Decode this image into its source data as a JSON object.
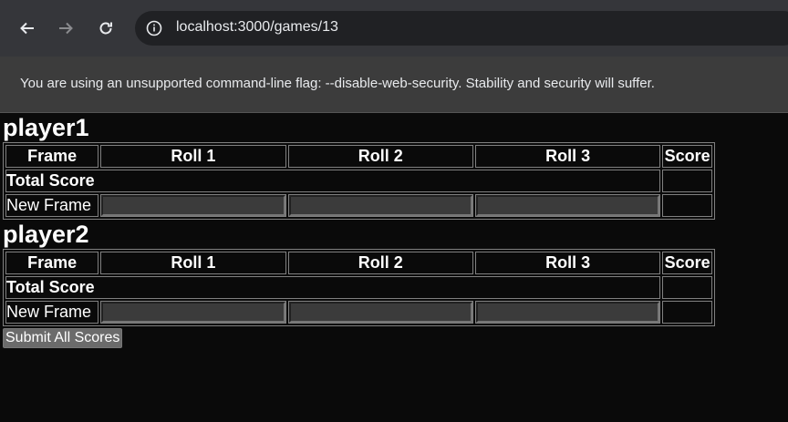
{
  "browser": {
    "url": "localhost:3000/games/13",
    "back_icon": "arrow-left-icon",
    "forward_icon": "arrow-right-icon",
    "reload_icon": "reload-icon",
    "site_info_icon": "info-icon"
  },
  "infobar": {
    "message": "You are using an unsupported command-line flag: --disable-web-security. Stability and security will suffer."
  },
  "players": [
    {
      "name": "player1",
      "headers": [
        "Frame",
        "Roll 1",
        "Roll 2",
        "Roll 3",
        "Score"
      ],
      "total_label": "Total Score",
      "total_value": "",
      "new_frame_label": "New Frame",
      "rolls": [
        "",
        "",
        ""
      ],
      "new_frame_score": ""
    },
    {
      "name": "player2",
      "headers": [
        "Frame",
        "Roll 1",
        "Roll 2",
        "Roll 3",
        "Score"
      ],
      "total_label": "Total Score",
      "total_value": "",
      "new_frame_label": "New Frame",
      "rolls": [
        "",
        "",
        ""
      ],
      "new_frame_score": ""
    }
  ],
  "submit_label": "Submit All Scores",
  "colors": {
    "page_bg": "#0a0a0a",
    "toolbar_bg": "#35363a",
    "omnibox_bg": "#202124",
    "infobar_bg": "#3c3c3c",
    "input_bg": "#3b3b3b",
    "button_bg": "#6b6b6b"
  }
}
